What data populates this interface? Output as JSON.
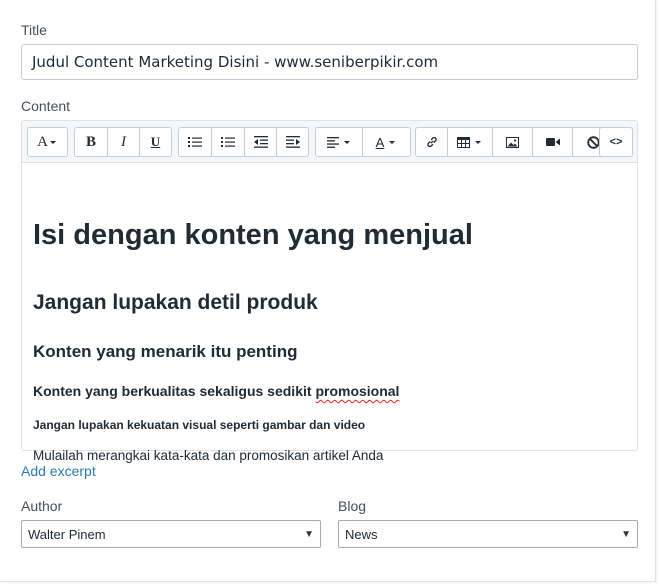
{
  "title_field": {
    "label": "Title",
    "value": "Judul Content Marketing Disini - www.seniberpikir.com"
  },
  "content_field": {
    "label": "Content"
  },
  "toolbar": {
    "font_button": "A",
    "bold": "B",
    "italic": "I",
    "underline": "U",
    "color_button": "A",
    "html_button": "<>"
  },
  "editor_content": {
    "h1": "Isi dengan konten yang menjual",
    "h2": "Jangan lupakan detil produk",
    "h3": "Konten yang menarik itu penting",
    "h4_prefix": "Konten yang berkualitas sekaligus sedikit ",
    "h4_spelled": "promosional",
    "h5": "Jangan lupakan kekuatan visual seperti gambar dan video",
    "paragraph": "Mulailah merangkai kata-kata dan promosikan artikel Anda"
  },
  "add_excerpt": "Add excerpt",
  "author": {
    "label": "Author",
    "selected": "Walter Pinem"
  },
  "blog": {
    "label": "Blog",
    "selected": "News"
  },
  "colors": {
    "link": "#2a79b5",
    "border": "#c4cdd5",
    "toolbar_bg": "#f4f6f8"
  }
}
